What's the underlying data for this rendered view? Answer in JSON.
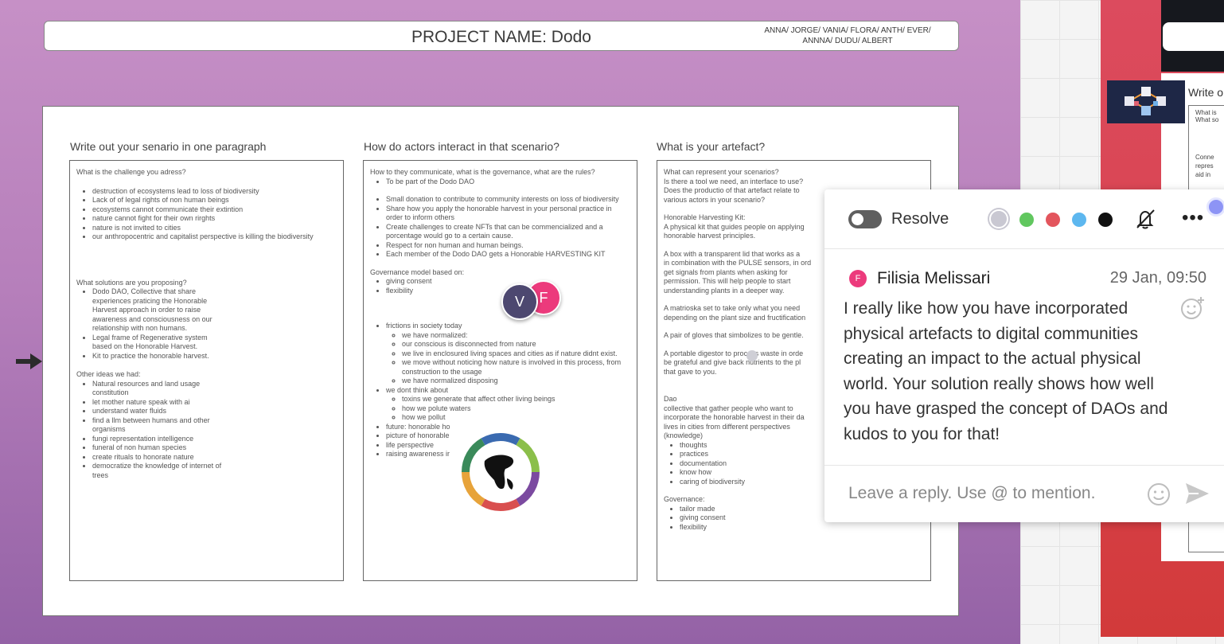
{
  "header": {
    "project_title": "PROJECT NAME: Dodo",
    "members_line1": "ANNA/ JORGE/ VANIA/ FLORA/ ANTH/ EVER/",
    "members_line2": "ANNNA/ DUDU/ ALBERT"
  },
  "columns": [
    {
      "heading": "Write out your senario in one paragraph",
      "q1": "What is the challenge you adress?",
      "q1_items": [
        "destruction of ecosystems lead to loss of biodiversity",
        "Lack of of legal rights of non human beings",
        "ecosystems cannot communicate their extintion",
        "nature cannot fight for their own rirghts",
        "nature is not invited to cities",
        "our anthropocentric and capitalist perspective is killing the biodiversity"
      ],
      "q2": "What solutions are you proposing?",
      "q2_items": [
        "Dodo DAO, Collective that share experiences praticing the Honorable Harvest approach in order to raise awareness and consciousness on our relationship with non humans.",
        "Legal frame of Regenerative system based on the Honorable Harvest.",
        "Kit to practice the honorable harvest."
      ],
      "q3": "Other ideas we had:",
      "q3_items": [
        "Natural resources and land usage constitution",
        "let mother nature speak with ai",
        "understand water fluids",
        "find a llm between humans and other organisms",
        "fungi representation intelligence",
        "funeral of non human species",
        "create rituals to honorate nature",
        "democratize the knowledge of internet of trees"
      ]
    },
    {
      "heading": "How do actors interact in that scenario?",
      "q1": "How to they communicate, what is the governance, what are the rules?",
      "q1_items": [
        "To be part of the Dodo DAO",
        "Small donation to contribute to community interests on loss of biodiversity",
        "Share how you apply the honorable harvest in your personal practice in order to inform others",
        "Create challenges to create NFTs that can be commencialized and a porcentage would go to a certain cause.",
        "Respect for non human and human beings.",
        "Each member of the Dodo DAO gets a Honorable HARVESTING KIT"
      ],
      "q2": "Governance model based on:",
      "q2_items": [
        "giving consent",
        "flexibility"
      ],
      "q3_item": "frictions in society today",
      "q3_sub": [
        "we have normalized:",
        "our conscious is disconnected from nature",
        "we live in enclosured living spaces and cities as if nature didnt exist.",
        "we move without noticing how nature is involved in this process, from construction to the usage",
        "we have normalized disposing"
      ],
      "q4_item": "we dont think about",
      "q4_sub": [
        "toxins we generate that affect other living beings",
        "how we polute waters",
        "how we pollut"
      ],
      "q5_items": [
        "future: honorable ho",
        "picture of honorable",
        "life perspective",
        "raising awareness ir"
      ]
    },
    {
      "heading": "What is your artefact?",
      "p1": "What can represent your scenarios?",
      "p2": "Is there a tool we need, an interface to use?",
      "p3": "Does the productio of that artefact relate to",
      "p4": "various actors in your scenario?",
      "kit_title": "Honorable Harvesting Kit:",
      "kit_l1": "A physical kit that guides people on applying",
      "kit_l2": "honorable harvest principles.",
      "box_l1": "A box with a transparent lid that works as a",
      "box_l2": "in combination with the PULSE sensors, in ord",
      "box_l3": "get signals from plants when asking for",
      "box_l4": "permission. This will help people to start",
      "box_l5": "understanding plants in a deeper way.",
      "mat_l1": "A matrioska set to take only what you need",
      "mat_l2": "depending on the plant size and fructification",
      "gloves": "A pair of gloves that simbolizes to be gentle.",
      "dig_l1": "A portable digestor to process waste in orde",
      "dig_l2": "be grateful and give back nutrients to the pl",
      "dig_l3": "that gave to you.",
      "dao_title": "Dao",
      "dao_l1": "collective that gather people who want to",
      "dao_l2": "incorporate the honorable harvest in their da",
      "dao_l3": "lives in cities from different perspectives",
      "dao_l4": "(knowledge)",
      "dao_items": [
        "thoughts",
        "practices",
        "documentation",
        "know how",
        "caring of biodiversity"
      ],
      "gov_title": "Governance:",
      "gov_items": [
        "tailor made",
        "giving consent",
        "flexibility"
      ]
    }
  ],
  "avatars": {
    "v": "V",
    "f": "F"
  },
  "comment_panel": {
    "resolve_label": "Resolve",
    "colors": [
      "#c9c8d2",
      "#61c75f",
      "#e3555d",
      "#5db7ef",
      "#111111"
    ],
    "author_initial": "F",
    "author": "Filisia Melissari",
    "date": "29 Jan, 09:50",
    "comment": "I really like how you have incorporated physical artefacts to digital communities creating an impact to the actual physical world. Your solution really shows how well you have grasped the concept of DAOs and kudos to you for that!",
    "reply_placeholder": "Leave a reply. Use @ to mention."
  },
  "right_card": {
    "title": "Write o",
    "q1": "What is",
    "q2": "What so",
    "t1": "Conne",
    "t2": "repres",
    "t3": "aid in"
  },
  "icons": [
    "arrow-right-icon",
    "bell-off-icon",
    "more-icon",
    "emoji-add-icon",
    "smile-icon",
    "send-icon",
    "network-logo-icon",
    "earth-emblem-icon"
  ]
}
